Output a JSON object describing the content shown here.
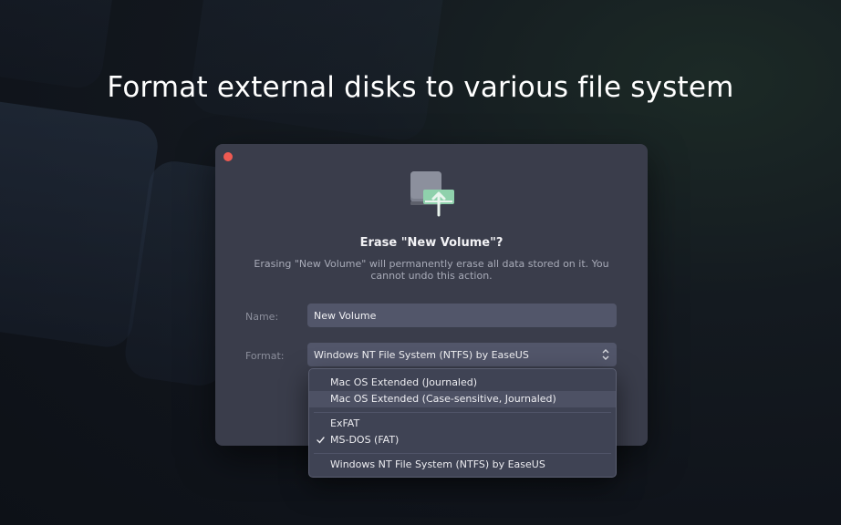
{
  "headline": "Format external disks to various file system",
  "dialog": {
    "title": "Erase \"New Volume\"?",
    "description": "Erasing \"New Volume\" will permanently erase all data stored on it. You cannot undo this action.",
    "name_label": "Name:",
    "name_value": "New Volume",
    "format_label": "Format:",
    "format_value": "Windows NT File System (NTFS) by EaseUS"
  },
  "dropdown": {
    "options": [
      {
        "label": "Mac OS Extended (Journaled)"
      },
      {
        "label": "Mac OS Extended (Case-sensitive, Journaled)",
        "highlighted": true
      },
      {
        "label": "ExFAT"
      },
      {
        "label": "MS-DOS (FAT)",
        "checked": true
      },
      {
        "label": "Windows NT File System (NTFS) by EaseUS"
      }
    ]
  },
  "icons": {
    "close": "close-dot-icon",
    "disk": "external-disk-icon",
    "stepper": "updown-chevron-icon",
    "check": "checkmark-icon"
  },
  "colors": {
    "dialog_bg": "#3a3d4b",
    "close_red": "#ee5a52",
    "disk_accent": "#8fd1ac",
    "field_bg": "#52566a",
    "menu_highlight": "#4d5164"
  }
}
